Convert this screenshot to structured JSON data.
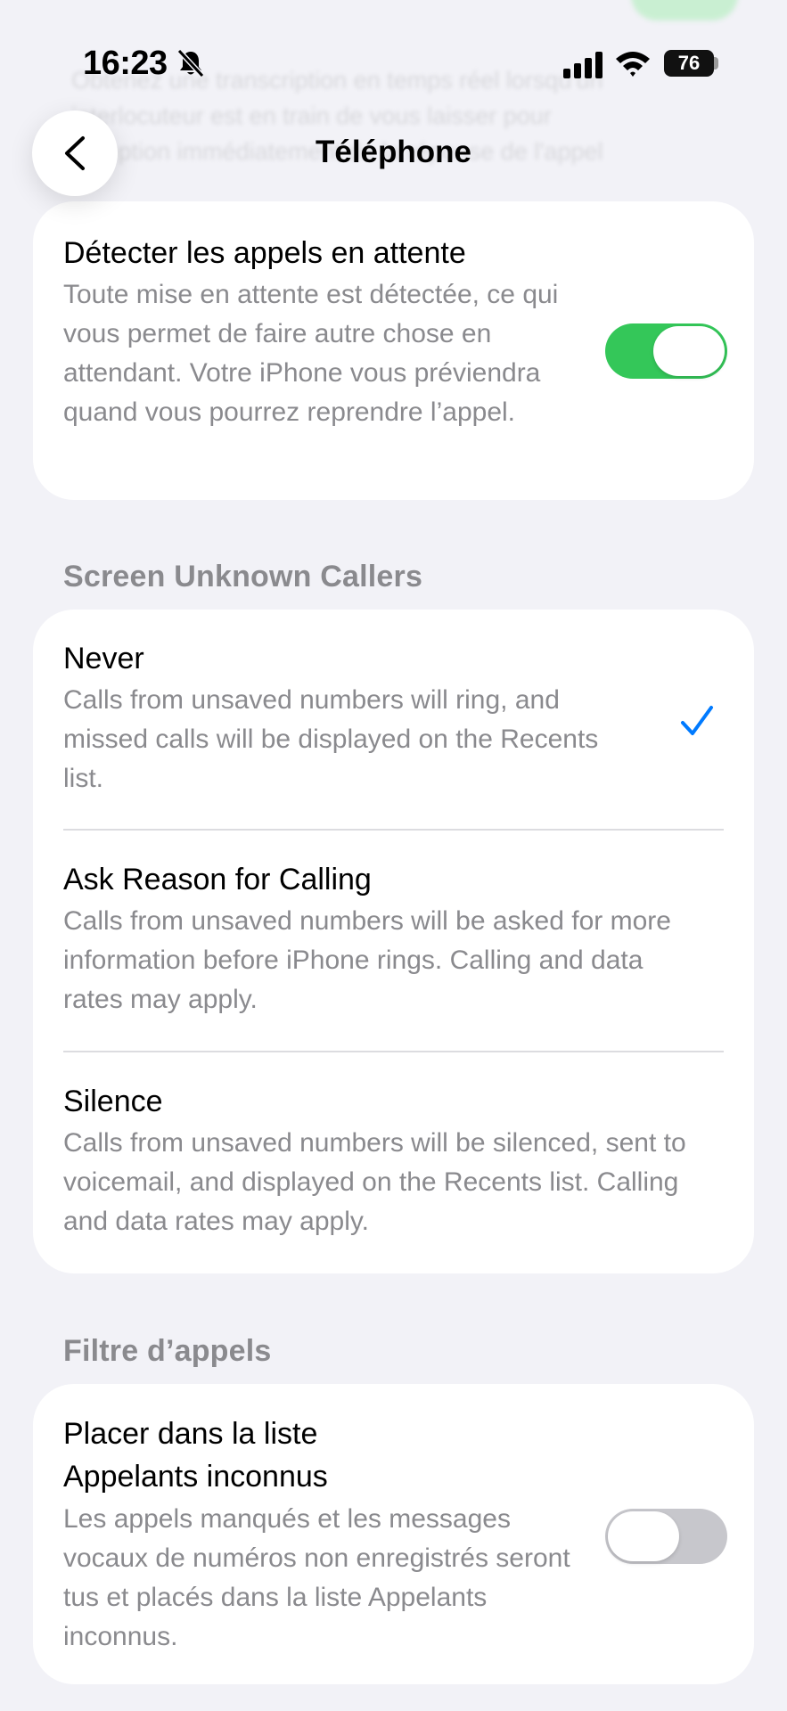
{
  "status_bar": {
    "time": "16:23",
    "battery": "76"
  },
  "background_text": "Obtenez une transcription en temps réel lorsqu'un interlocuteur est en train de vous laisser pour réception immédiatement de la réponse de l'appel",
  "nav": {
    "title": "Téléphone"
  },
  "hold_detection": {
    "title": "Détecter les appels en attente",
    "description": "Toute mise en attente est détectée, ce qui vous permet de faire autre chose en attendant. Votre iPhone vous préviendra quand vous pourrez reprendre l’appel.",
    "enabled": true
  },
  "screen_unknown": {
    "header": "Screen Unknown Callers",
    "options": [
      {
        "title": "Never",
        "description": "Calls from unsaved numbers will ring, and missed calls will be displayed on the Recents list.",
        "selected": true
      },
      {
        "title": "Ask Reason for Calling",
        "description": "Calls from unsaved numbers will be asked for more information before iPhone rings. Calling and data rates may apply.",
        "selected": false
      },
      {
        "title": "Silence",
        "description": "Calls from unsaved numbers will be silenced, sent to voicemail, and displayed on the Recents list. Calling and data rates may apply.",
        "selected": false
      }
    ]
  },
  "call_filter": {
    "header": "Filtre d’appels",
    "title": "Placer dans la liste Appelants inconnus",
    "description": "Les appels manqués et les messages vocaux de numéros non enregistrés seront tus et placés dans la liste Appelants inconnus.",
    "enabled": false
  },
  "colors": {
    "accent": "#007aff",
    "toggle_on": "#34c759",
    "toggle_off": "#c7c7cc",
    "background": "#f2f2f7"
  }
}
